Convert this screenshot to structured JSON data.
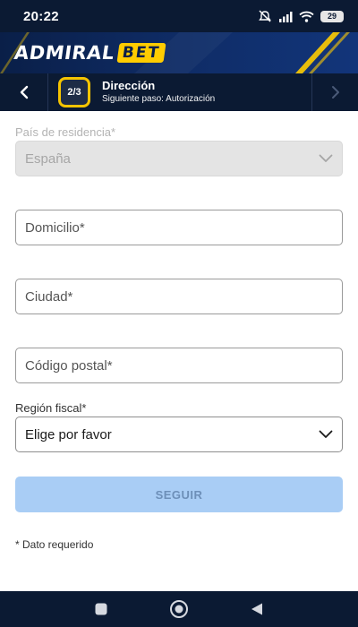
{
  "status_bar": {
    "time": "20:22",
    "battery": "29",
    "icons": [
      "mute-icon",
      "signal-icon",
      "wifi-icon",
      "battery-icon"
    ]
  },
  "brand": {
    "logo_text_1": "ADMIRAL",
    "logo_text_2": "BET",
    "accent": "#ffcc00",
    "background": "#0f2c66"
  },
  "step": {
    "badge": "2/3",
    "title": "Dirección",
    "next": "Siguiente paso: Autorización",
    "back_icon": "chevron-left-icon",
    "forward_icon": "chevron-right-icon"
  },
  "form": {
    "country": {
      "label": "País de residencia*",
      "value": "España"
    },
    "address": {
      "placeholder": "Domicilio*"
    },
    "city": {
      "placeholder": "Ciudad*"
    },
    "postal_code": {
      "placeholder": "Código postal*"
    },
    "tax_region": {
      "label": "Región fiscal*",
      "value": "Elige por favor"
    },
    "submit_label": "SEGUIR",
    "required_note": "* Dato requerido"
  },
  "android_nav": [
    "recents-icon",
    "home-icon",
    "back-icon"
  ]
}
